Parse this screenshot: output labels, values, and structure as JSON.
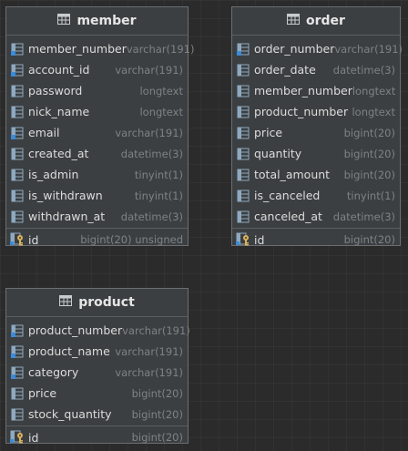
{
  "colors": {
    "background": "#2b2b2b",
    "table_bg": "#3c3f41",
    "border": "#6b6f72",
    "column_icon": "#8ea9c0",
    "key_icon": "#d9b25a"
  },
  "tables": [
    {
      "name": "member",
      "columns": [
        {
          "name": "member_number",
          "type": "varchar(191)",
          "icon": "column-indexed-icon"
        },
        {
          "name": "account_id",
          "type": "varchar(191)",
          "icon": "column-indexed-icon"
        },
        {
          "name": "password",
          "type": "longtext",
          "icon": "column-icon"
        },
        {
          "name": "nick_name",
          "type": "longtext",
          "icon": "column-icon"
        },
        {
          "name": "email",
          "type": "varchar(191)",
          "icon": "column-indexed-icon"
        },
        {
          "name": "created_at",
          "type": "datetime(3)",
          "icon": "column-icon"
        },
        {
          "name": "is_admin",
          "type": "tinyint(1)",
          "icon": "column-icon"
        },
        {
          "name": "is_withdrawn",
          "type": "tinyint(1)",
          "icon": "column-icon"
        },
        {
          "name": "withdrawn_at",
          "type": "datetime(3)",
          "icon": "column-icon"
        }
      ],
      "primary_key": {
        "name": "id",
        "type": "bigint(20) unsigned",
        "icon": "primary-key-icon"
      }
    },
    {
      "name": "order",
      "columns": [
        {
          "name": "order_number",
          "type": "varchar(191)",
          "icon": "column-indexed-icon"
        },
        {
          "name": "order_date",
          "type": "datetime(3)",
          "icon": "column-icon"
        },
        {
          "name": "member_number",
          "type": "longtext",
          "icon": "column-icon"
        },
        {
          "name": "product_number",
          "type": "longtext",
          "icon": "column-icon"
        },
        {
          "name": "price",
          "type": "bigint(20)",
          "icon": "column-icon"
        },
        {
          "name": "quantity",
          "type": "bigint(20)",
          "icon": "column-icon"
        },
        {
          "name": "total_amount",
          "type": "bigint(20)",
          "icon": "column-icon"
        },
        {
          "name": "is_canceled",
          "type": "tinyint(1)",
          "icon": "column-icon"
        },
        {
          "name": "canceled_at",
          "type": "datetime(3)",
          "icon": "column-icon"
        }
      ],
      "primary_key": {
        "name": "id",
        "type": "bigint(20)",
        "icon": "primary-key-icon"
      }
    },
    {
      "name": "product",
      "columns": [
        {
          "name": "product_number",
          "type": "varchar(191)",
          "icon": "column-indexed-icon"
        },
        {
          "name": "product_name",
          "type": "varchar(191)",
          "icon": "column-indexed-icon"
        },
        {
          "name": "category",
          "type": "varchar(191)",
          "icon": "column-indexed-icon"
        },
        {
          "name": "price",
          "type": "bigint(20)",
          "icon": "column-icon"
        },
        {
          "name": "stock_quantity",
          "type": "bigint(20)",
          "icon": "column-icon"
        }
      ],
      "primary_key": {
        "name": "id",
        "type": "bigint(20)",
        "icon": "primary-key-icon"
      }
    }
  ]
}
